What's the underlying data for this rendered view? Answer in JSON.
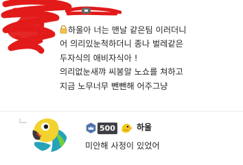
{
  "post": {
    "lines": [
      "하울아 너는 맨날 같은팀 이러더니",
      "어 의리있눈척하더니 종나 벌레같은",
      "두자식의 애비자식아 !",
      "의리없눈새꺄 씨봉알 노쇼를 쳐하고",
      "지금 노무너무 뺀뺀해 어주그냥"
    ],
    "icons": [
      "lock-icon"
    ]
  },
  "reply": {
    "level": "500",
    "name": "하울",
    "text": "미안해 사정이 있었어",
    "icons": [
      "reply-arrow-icon",
      "parrot-avatar",
      "crown-badge-icon",
      "bird-icon"
    ]
  },
  "colors": {
    "scribble": "#e31a1a",
    "badge_bg": "#3f3f46",
    "divider": "#ececec"
  }
}
